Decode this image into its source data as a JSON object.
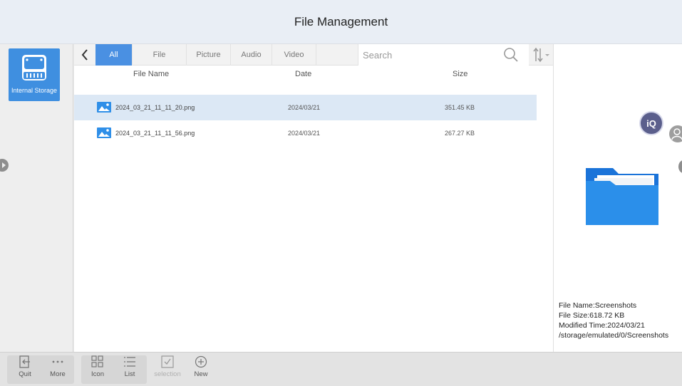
{
  "window": {
    "title": "File Management"
  },
  "sidebar": {
    "storage_label": "Internal Storage"
  },
  "tabs": [
    "All",
    "File",
    "Picture",
    "Audio",
    "Video"
  ],
  "active_tab": "All",
  "search": {
    "placeholder": "Search"
  },
  "columns": {
    "name": "File Name",
    "date": "Date",
    "size": "Size"
  },
  "files": [
    {
      "name": "2024_03_21_11_11_20.png",
      "date": "2024/03/21",
      "size": "351.45 KB",
      "selected": true
    },
    {
      "name": "2024_03_21_11_11_56.png",
      "date": "2024/03/21",
      "size": "267.27 KB",
      "selected": false
    }
  ],
  "details": {
    "name": "File Name:Screenshots",
    "size": "File Size:618.72 KB",
    "modified": "Modified Time:2024/03/21",
    "path": "/storage/emulated/0/Screenshots"
  },
  "badge": {
    "iq_label": "iQ"
  },
  "toolbar": {
    "quit": "Quit",
    "more": "More",
    "icon": "Icon",
    "list": "List",
    "selection": "selection",
    "new": "New"
  },
  "colors": {
    "accent": "#4a90e2",
    "storage_tile": "#3f8fe0",
    "selected_row": "#dce8f5"
  }
}
